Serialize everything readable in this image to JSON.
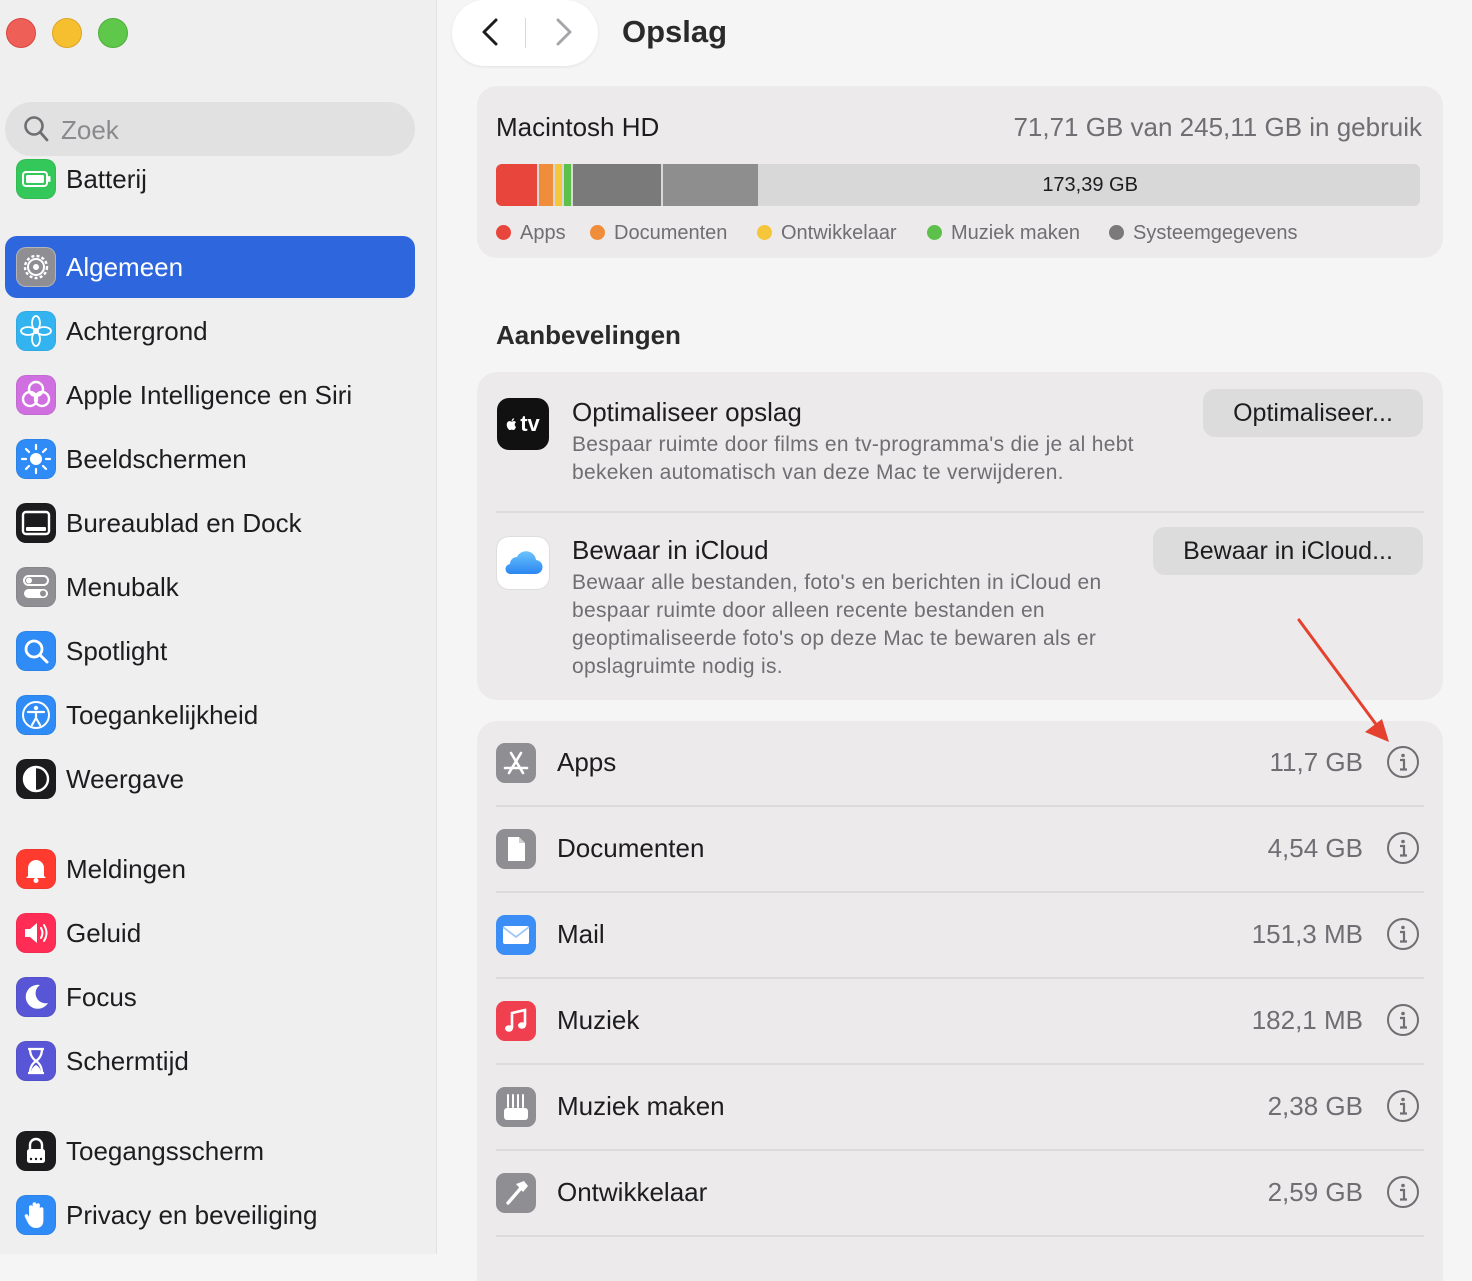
{
  "window": {
    "title": "Opslag"
  },
  "sidebar": {
    "search_placeholder": "Zoek",
    "items": [
      {
        "label": "Batterij",
        "icon": "battery-icon",
        "color": "#34c759"
      },
      {
        "label": "Algemeen",
        "icon": "gear-icon",
        "color": "#8e8e93",
        "active": true
      },
      {
        "label": "Achtergrond",
        "icon": "flower-icon",
        "color": "#33b4f0"
      },
      {
        "label": "Apple Intelligence en Siri",
        "icon": "siri-icon",
        "color": "#d070e0"
      },
      {
        "label": "Beeldschermen",
        "icon": "sun-icon",
        "color": "#2f8cf6"
      },
      {
        "label": "Bureaublad en Dock",
        "icon": "dock-icon",
        "color": "#1c1c1e"
      },
      {
        "label": "Menubalk",
        "icon": "toggle-icon",
        "color": "#8e8e93"
      },
      {
        "label": "Spotlight",
        "icon": "magnifier-icon",
        "color": "#2f8cf6"
      },
      {
        "label": "Toegankelijkheid",
        "icon": "accessibility-icon",
        "color": "#2f8cf6"
      },
      {
        "label": "Weergave",
        "icon": "appearance-icon",
        "color": "#1c1c1e"
      },
      {
        "label": "Meldingen",
        "icon": "bell-icon",
        "color": "#ff3b30"
      },
      {
        "label": "Geluid",
        "icon": "speaker-icon",
        "color": "#ff2d55"
      },
      {
        "label": "Focus",
        "icon": "moon-icon",
        "color": "#5856d6"
      },
      {
        "label": "Schermtijd",
        "icon": "hourglass-icon",
        "color": "#5856d6"
      },
      {
        "label": "Toegangsscherm",
        "icon": "lock-icon",
        "color": "#1c1c1e"
      },
      {
        "label": "Privacy en beveiliging",
        "icon": "hand-icon",
        "color": "#2f8cf6"
      }
    ]
  },
  "storage": {
    "disk_name": "Macintosh HD",
    "usage_text": "71,71 GB van 245,11 GB in gebruik",
    "free_label": "173,39 GB",
    "segments": [
      {
        "name": "Apps",
        "fraction": 0.046,
        "color": "#e8453c"
      },
      {
        "name": "Documenten",
        "fraction": 0.018,
        "color": "#f08d3a"
      },
      {
        "name": "Ontwikkelaar",
        "fraction": 0.01,
        "color": "#f5c53a"
      },
      {
        "name": "Muziek maken",
        "fraction": 0.009,
        "color": "#5cc04a"
      },
      {
        "name": "Systeem-a",
        "fraction": 0.098,
        "color": "#7a7a7a"
      },
      {
        "name": "Systeem-b",
        "fraction": 0.105,
        "color": "#8e8e8e"
      }
    ],
    "legend": [
      {
        "label": "Apps",
        "color": "#e8453c"
      },
      {
        "label": "Documenten",
        "color": "#f08d3a"
      },
      {
        "label": "Ontwikkelaar",
        "color": "#f5c53a"
      },
      {
        "label": "Muziek maken",
        "color": "#5cc04a"
      },
      {
        "label": "Systeemgegevens",
        "color": "#7a7a7a"
      }
    ]
  },
  "recommendations": {
    "title": "Aanbevelingen",
    "items": [
      {
        "title": "Optimaliseer opslag",
        "description": "Bespaar ruimte door films en tv-programma's die je al hebt bekeken automatisch van deze Mac te verwijderen.",
        "button": "Optimaliseer...",
        "icon": "appletv-icon",
        "icon_text": "tv"
      },
      {
        "title": "Bewaar in iCloud",
        "description": "Bewaar alle bestanden, foto's en berichten in iCloud en bespaar ruimte door alleen recente bestanden en geoptimaliseerde foto's op deze Mac te bewaren als er opslagruimte nodig is.",
        "button": "Bewaar in iCloud...",
        "icon": "icloud-icon"
      }
    ]
  },
  "categories": [
    {
      "name": "Apps",
      "size": "11,7 GB",
      "icon": "appstore-icon",
      "color": "#8e8e93"
    },
    {
      "name": "Documenten",
      "size": "4,54 GB",
      "icon": "document-icon",
      "color": "#8e8e93"
    },
    {
      "name": "Mail",
      "size": "151,3 MB",
      "icon": "mail-icon",
      "color": "#3b8ef5"
    },
    {
      "name": "Muziek",
      "size": "182,1 MB",
      "icon": "music-icon",
      "color": "#f0404f"
    },
    {
      "name": "Muziek maken",
      "size": "2,38 GB",
      "icon": "music-creation-icon",
      "color": "#8e8e93"
    },
    {
      "name": "Ontwikkelaar",
      "size": "2,59 GB",
      "icon": "hammer-icon",
      "color": "#8e8e93"
    }
  ],
  "annotation": {
    "arrow_color": "#e5412f"
  }
}
